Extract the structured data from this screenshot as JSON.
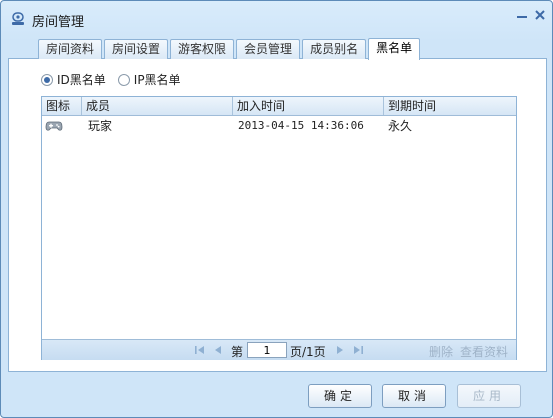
{
  "window": {
    "title": "房间管理"
  },
  "tabs": [
    {
      "label": "房间资料"
    },
    {
      "label": "房间设置"
    },
    {
      "label": "游客权限"
    },
    {
      "label": "会员管理"
    },
    {
      "label": "成员别名"
    },
    {
      "label": "黑名单",
      "active": true
    }
  ],
  "filter": {
    "options": [
      {
        "label": "ID黑名单",
        "selected": true
      },
      {
        "label": "IP黑名单",
        "selected": false
      }
    ]
  },
  "table": {
    "columns": [
      "图标",
      "成员",
      "加入时间",
      "到期时间"
    ],
    "rows": [
      {
        "icon": "gamepad-icon",
        "member": "玩家",
        "joined": "2013-04-15 14:36:06",
        "expires": "永久"
      }
    ]
  },
  "pager": {
    "prefix": "第",
    "page_value": "1",
    "suffix": "页/1页",
    "delete_label": "删除",
    "view_profile_label": "查看资料"
  },
  "footer": {
    "ok_label": "确定",
    "cancel_label": "取消",
    "apply_label": "应用"
  },
  "colors": {
    "frame_border": "#5d8bb8",
    "background": "#cfe5f8",
    "accent": "#3d6aa7"
  }
}
